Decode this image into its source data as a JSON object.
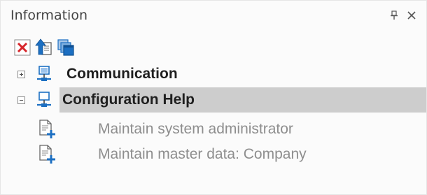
{
  "panel": {
    "title": "Information"
  },
  "tree": {
    "nodes": [
      {
        "label": "Communication",
        "expanded": false
      },
      {
        "label": "Configuration Help",
        "expanded": true,
        "selected": true,
        "children": [
          {
            "label": "Maintain system administrator"
          },
          {
            "label": "Maintain master data: Company"
          }
        ]
      }
    ]
  },
  "colors": {
    "selection": "#cdcdcd",
    "leaf_text": "#8e8e8e",
    "node_text": "#1f1f1f",
    "icon_blue": "#1c6fc2",
    "delete_red": "#d6262b"
  },
  "icons": {
    "pin": "pin-icon",
    "close": "close-icon",
    "delete": "delete-icon",
    "import": "import-icon",
    "windows": "windows-icon",
    "network": "network-icon",
    "document_add": "document-add-icon"
  }
}
